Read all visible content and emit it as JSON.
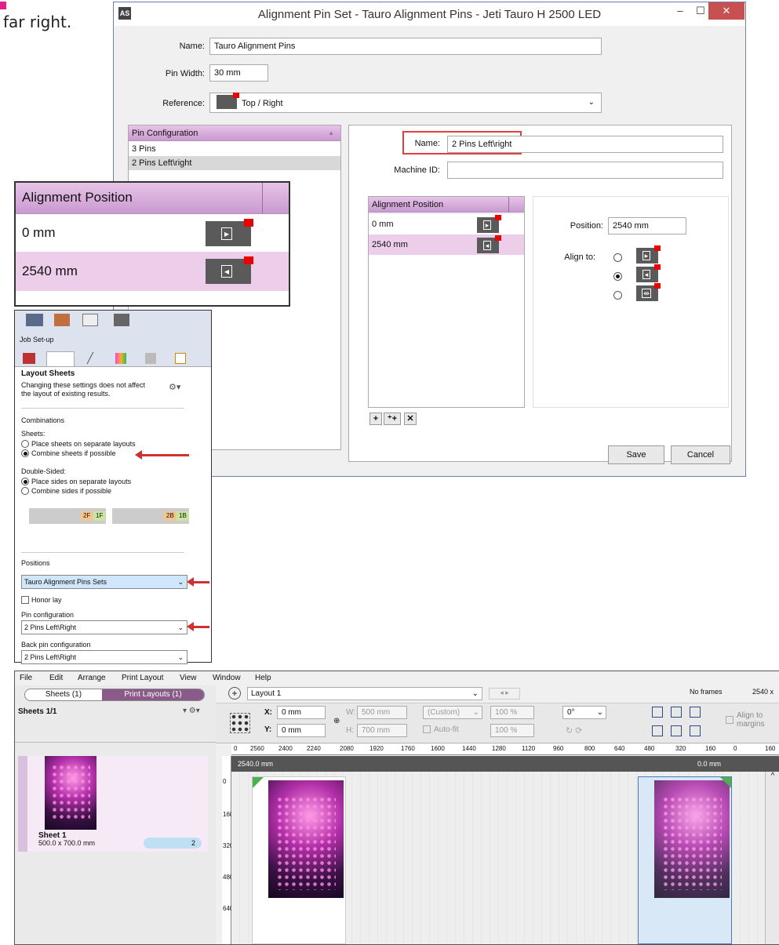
{
  "intro_text": "far right.",
  "dialog": {
    "title": "Alignment Pin Set - Tauro Alignment Pins - Jeti Tauro H 2500 LED",
    "app_badge": "AS",
    "name_label": "Name:",
    "name_value": "Tauro Alignment Pins",
    "pin_width_label": "Pin Width:",
    "pin_width_value": "30 mm",
    "reference_label": "Reference:",
    "reference_value": "Top / Right",
    "pin_config_header": "Pin Configuration",
    "pin_configs": [
      "3 Pins",
      "2 Pins Left\\right"
    ],
    "config_name_label": "Name:",
    "config_name_value": "2 Pins Left\\right",
    "machine_id_label": "Machine ID:",
    "machine_id_value": "",
    "align_header": "Alignment Position",
    "align_rows": [
      "0 mm",
      "2540 mm"
    ],
    "position_label": "Position:",
    "position_value": "2540 mm",
    "align_to_label": "Align to:",
    "save_label": "Save",
    "cancel_label": "Cancel"
  },
  "zoom": {
    "header": "Alignment Position",
    "rows": [
      "0 mm",
      "2540 mm"
    ]
  },
  "layout_panel": {
    "job_setup": "Job Set-up",
    "title": "Layout Sheets",
    "note": "Changing these settings does not affect the layout of existing results.",
    "combinations": "Combinations",
    "sheets_label": "Sheets:",
    "sheet_opt1": "Place sheets on separate layouts",
    "sheet_opt2": "Combine sheets if possible",
    "double_label": "Double-Sided:",
    "double_opt1": "Place sides on separate layouts",
    "double_opt2": "Combine sides if possible",
    "tag_2f": "2F",
    "tag_1f": "1F",
    "tag_2b": "2B",
    "tag_1b": "1B",
    "positions_label": "Positions",
    "positions_value": "Tauro Alignment Pins Sets",
    "honor_lay": "Honor lay",
    "pin_config_label": "Pin configuration",
    "pin_config_value": "2 Pins Left\\Right",
    "back_pin_label": "Back pin configuration",
    "back_pin_value": "2 Pins Left\\Right"
  },
  "app": {
    "menu": [
      "File",
      "Edit",
      "Arrange",
      "Print Layout",
      "View",
      "Window",
      "Help"
    ],
    "tab_sheets": "Sheets (1)",
    "tab_layouts": "Print Layouts (1)",
    "layout_select": "Layout 1",
    "no_frames": "No frames",
    "size_readout": "2540 x",
    "sheets_title": "Sheets 1/1",
    "x_label": "X:",
    "x_value": "0 mm",
    "y_label": "Y:",
    "y_value": "0 mm",
    "w_label": "W:",
    "w_value": "500 mm",
    "h_label": "H:",
    "h_value": "700 mm",
    "preset": "(Custom)",
    "autofit": "Auto-fit",
    "scale_w": "100 %",
    "scale_h": "100 %",
    "rotation": "0°",
    "align_margins": "Align to margins",
    "ruler_ticks": [
      "0",
      "2560",
      "2400",
      "2240",
      "2080",
      "1920",
      "1760",
      "1600",
      "1440",
      "1280",
      "1120",
      "960",
      "800",
      "640",
      "480",
      "320",
      "160",
      "0",
      "160"
    ],
    "left_readout": "2540.0 mm",
    "right_readout": "0.0 mm",
    "vruler": [
      "0",
      "160",
      "320",
      "480",
      "640"
    ],
    "sheet_name": "Sheet 1",
    "sheet_size": "500.0 x 700.0 mm",
    "sheet_count": "2"
  }
}
